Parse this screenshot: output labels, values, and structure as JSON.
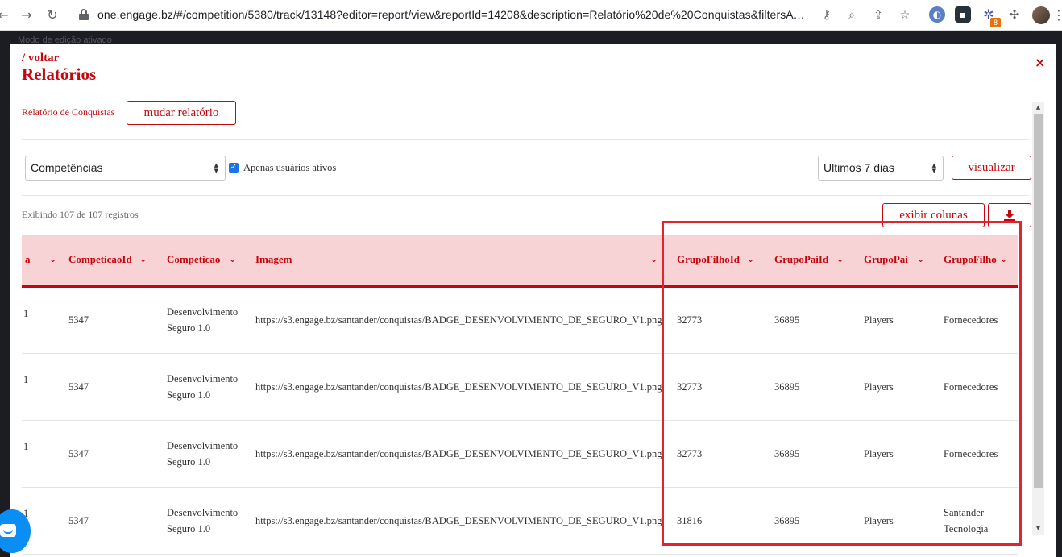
{
  "browser": {
    "url": "one.engage.bz/#/competition/5380/track/13148?editor=report/view&reportId=14208&description=Relatório%20de%20Conquistas&filtersAv...",
    "extension_badge": "8"
  },
  "background_text": "Modo de edição ativado",
  "header": {
    "back_label": "/ voltar",
    "title": "Relatórios",
    "close_symbol": "×"
  },
  "report": {
    "name": "Relatório de Conquistas",
    "change_button": "mudar relatório"
  },
  "filters": {
    "category": "Competências",
    "active_only_label": "Apenas usuários ativos",
    "active_only_checked": true,
    "period": "Ultimos 7 dias",
    "view_button": "visualizar"
  },
  "records_info": "Exibindo 107 de 107 registros",
  "actions": {
    "columns_button": "exibir colunas",
    "download_icon": "download-icon"
  },
  "table": {
    "columns": [
      "a",
      "CompeticaoId",
      "Competicao",
      "Imagem",
      "GrupoFilhoId",
      "GrupoPaiId",
      "GrupoPai",
      "GrupoFilho"
    ],
    "rows": [
      [
        "1",
        "5347",
        "Desenvolvimento Seguro 1.0",
        "https://s3.engage.bz/santander/conquistas/BADGE_DESENVOLVIMENTO_DE_SEGURO_V1.png",
        "32773",
        "36895",
        "Players",
        "Fornecedores"
      ],
      [
        "1",
        "5347",
        "Desenvolvimento Seguro 1.0",
        "https://s3.engage.bz/santander/conquistas/BADGE_DESENVOLVIMENTO_DE_SEGURO_V1.png",
        "32773",
        "36895",
        "Players",
        "Fornecedores"
      ],
      [
        "1",
        "5347",
        "Desenvolvimento Seguro 1.0",
        "https://s3.engage.bz/santander/conquistas/BADGE_DESENVOLVIMENTO_DE_SEGURO_V1.png",
        "32773",
        "36895",
        "Players",
        "Fornecedores"
      ],
      [
        "1",
        "5347",
        "Desenvolvimento Seguro 1.0",
        "https://s3.engage.bz/santander/conquistas/BADGE_DESENVOLVIMENTO_DE_SEGURO_V1.png",
        "31816",
        "36895",
        "Players",
        "Santander Tecnologia"
      ]
    ]
  },
  "colors": {
    "accent": "#c5070d",
    "header_bg": "#f8d3d5",
    "highlight": "#e3232f"
  }
}
